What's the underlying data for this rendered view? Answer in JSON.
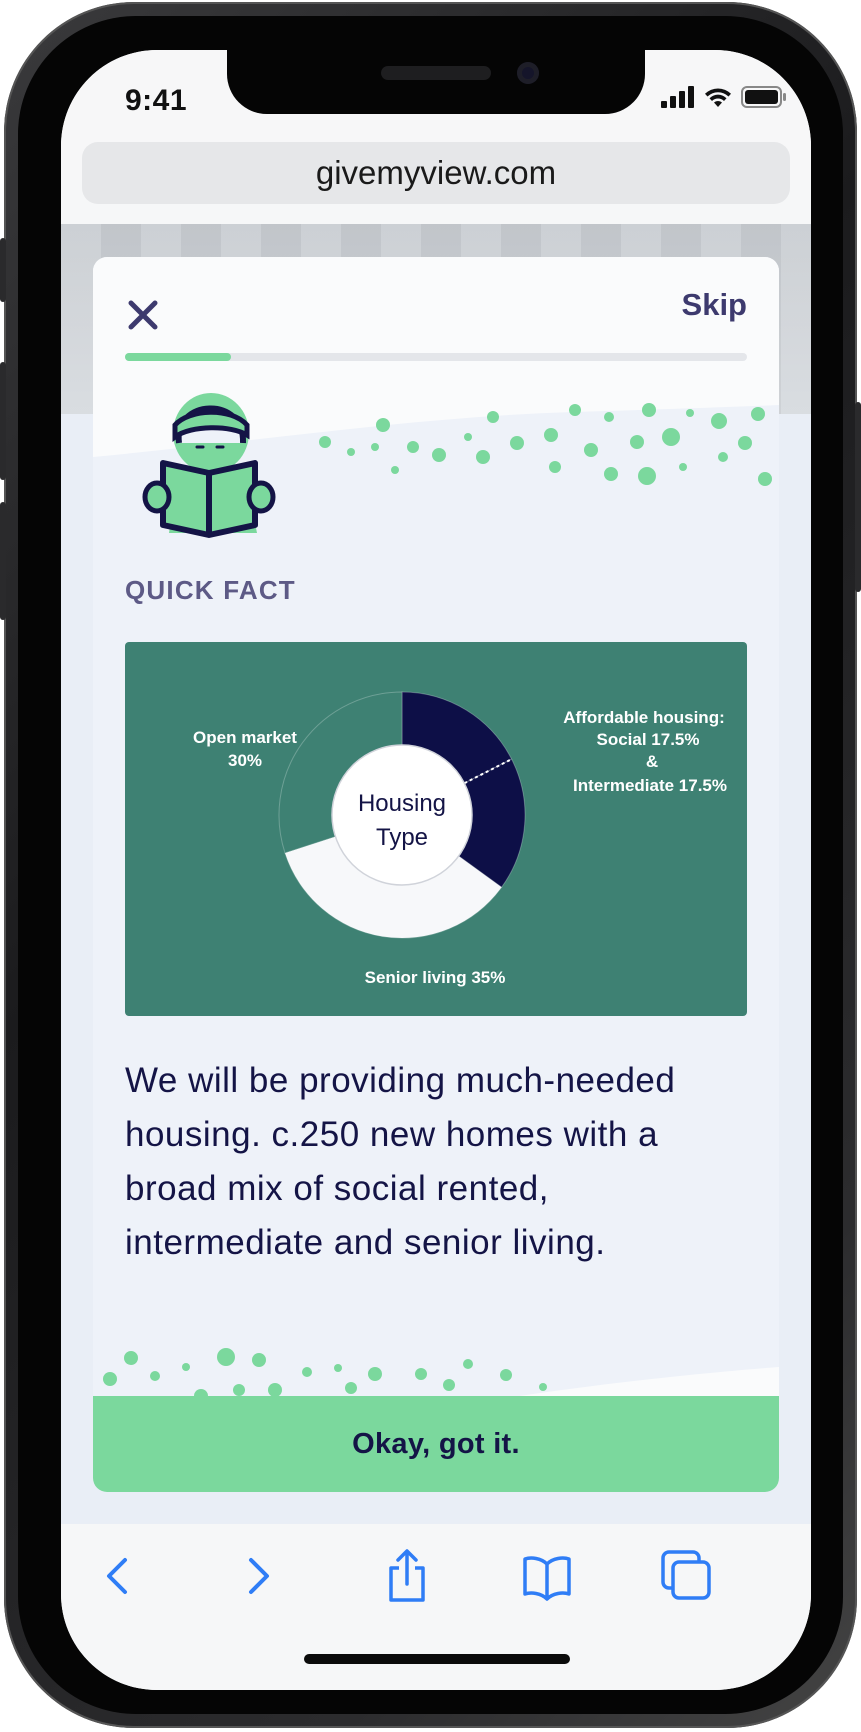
{
  "status_bar": {
    "time": "9:41"
  },
  "browser": {
    "url": "givemyview.com"
  },
  "modal": {
    "skip_label": "Skip",
    "progress": 0.17,
    "section_label": "QUICK FACT",
    "body_text": "We will be providing much-needed housing. c.250 new homes with a broad mix of social rented, intermediate and senior living.",
    "cta_label": "Okay, got it."
  },
  "chart_data": {
    "type": "pie",
    "center_label": [
      "Housing",
      "Type"
    ],
    "slices": [
      {
        "label": "Social",
        "value": 17.5,
        "color": "#0d0f47"
      },
      {
        "label": "Intermediate",
        "value": 17.5,
        "color": "#0d0f47"
      },
      {
        "label": "Senior living",
        "value": 35,
        "color": "#f7f8fa"
      },
      {
        "label": "Open market",
        "value": 30,
        "color": "#3e8173"
      }
    ],
    "annotations": {
      "open_market": [
        "Open market",
        "30%"
      ],
      "affordable": [
        "Affordable housing:",
        "Social 17.5%",
        "&",
        "Intermediate 17.5%"
      ],
      "senior": "Senior living 35%"
    }
  },
  "icons": {
    "close": "close-icon",
    "reader": "reader-illustration",
    "back": "back-chevron-icon",
    "forward": "forward-chevron-icon",
    "share": "share-icon",
    "bookmarks": "bookmarks-icon",
    "tabs": "tabs-icon"
  },
  "colors": {
    "accent_green": "#7bd89d",
    "navy": "#141446",
    "chart_bg": "#3e8173",
    "ios_blue": "#2f7df6"
  }
}
